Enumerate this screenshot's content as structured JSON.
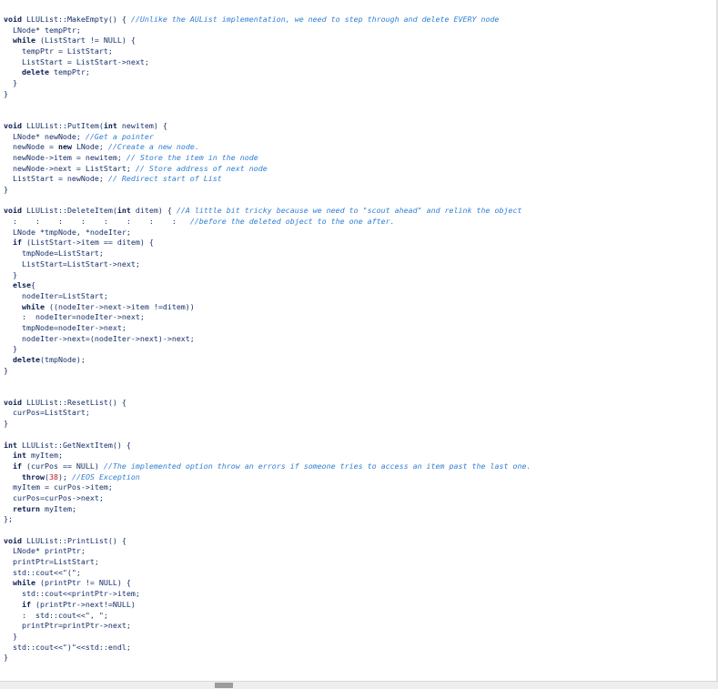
{
  "code": {
    "lines": [
      [
        {
          "k": "key",
          "t": "void "
        },
        {
          "k": "txt",
          "t": "LLUList::MakeEmpty() { "
        },
        {
          "k": "com",
          "t": "//Unlike the AUList implementation, we need to step through and delete EVERY node"
        }
      ],
      [
        {
          "k": "txt",
          "t": "  LNode* tempPtr;"
        }
      ],
      [
        {
          "k": "key",
          "t": "  while "
        },
        {
          "k": "txt",
          "t": "(ListStart != NULL) {"
        }
      ],
      [
        {
          "k": "txt",
          "t": "    tempPtr = ListStart;"
        }
      ],
      [
        {
          "k": "txt",
          "t": "    ListStart = ListStart->next;"
        }
      ],
      [
        {
          "k": "key",
          "t": "    delete "
        },
        {
          "k": "txt",
          "t": "tempPtr;"
        }
      ],
      [
        {
          "k": "txt",
          "t": "  }"
        }
      ],
      [
        {
          "k": "txt",
          "t": "}"
        }
      ],
      [],
      [],
      [
        {
          "k": "key",
          "t": "void "
        },
        {
          "k": "txt",
          "t": "LLUList::PutItem("
        },
        {
          "k": "key",
          "t": "int "
        },
        {
          "k": "txt",
          "t": "newitem) {"
        }
      ],
      [
        {
          "k": "txt",
          "t": "  LNode* newNode; "
        },
        {
          "k": "com",
          "t": "//Get a pointer"
        }
      ],
      [
        {
          "k": "txt",
          "t": "  newNode = "
        },
        {
          "k": "key",
          "t": "new "
        },
        {
          "k": "txt",
          "t": "LNode; "
        },
        {
          "k": "com",
          "t": "//Create a new node."
        }
      ],
      [
        {
          "k": "txt",
          "t": "  newNode->item = newitem; "
        },
        {
          "k": "com",
          "t": "// Store the item in the node"
        }
      ],
      [
        {
          "k": "txt",
          "t": "  newNode->next = ListStart; "
        },
        {
          "k": "com",
          "t": "// Store address of next node"
        }
      ],
      [
        {
          "k": "txt",
          "t": "  ListStart = newNode; "
        },
        {
          "k": "com",
          "t": "// Redirect start of List"
        }
      ],
      [
        {
          "k": "txt",
          "t": "}"
        }
      ],
      [],
      [
        {
          "k": "key",
          "t": "void "
        },
        {
          "k": "txt",
          "t": "LLUList::DeleteItem("
        },
        {
          "k": "key",
          "t": "int "
        },
        {
          "k": "txt",
          "t": "ditem) { "
        },
        {
          "k": "com",
          "t": "//A little bit tricky because we need to \"scout ahead\" and relink the object"
        }
      ],
      [
        {
          "k": "txt",
          "t": "  :    :    :    :    :    :    :    :   "
        },
        {
          "k": "com",
          "t": "//before the deleted object to the one after."
        }
      ],
      [
        {
          "k": "txt",
          "t": "  LNode *tmpNode, *nodeIter;"
        }
      ],
      [
        {
          "k": "key",
          "t": "  if "
        },
        {
          "k": "txt",
          "t": "(ListStart->item == ditem) {"
        }
      ],
      [
        {
          "k": "txt",
          "t": "    tmpNode=ListStart;"
        }
      ],
      [
        {
          "k": "txt",
          "t": "    ListStart=ListStart->next;"
        }
      ],
      [
        {
          "k": "txt",
          "t": "  }"
        }
      ],
      [
        {
          "k": "key",
          "t": "  else"
        },
        {
          "k": "txt",
          "t": "{"
        }
      ],
      [
        {
          "k": "txt",
          "t": "    nodeIter=ListStart;"
        }
      ],
      [
        {
          "k": "key",
          "t": "    while "
        },
        {
          "k": "txt",
          "t": "((nodeIter->next->item !=ditem))"
        }
      ],
      [
        {
          "k": "txt",
          "t": "    :  nodeIter=nodeIter->next;"
        }
      ],
      [
        {
          "k": "txt",
          "t": "    tmpNode=nodeIter->next;"
        }
      ],
      [
        {
          "k": "txt",
          "t": "    nodeIter->next=(nodeIter->next)->next;"
        }
      ],
      [
        {
          "k": "txt",
          "t": "  }"
        }
      ],
      [
        {
          "k": "key",
          "t": "  delete"
        },
        {
          "k": "txt",
          "t": "(tmpNode);"
        }
      ],
      [
        {
          "k": "txt",
          "t": "}"
        }
      ],
      [],
      [],
      [
        {
          "k": "key",
          "t": "void "
        },
        {
          "k": "txt",
          "t": "LLUList::ResetList() {"
        }
      ],
      [
        {
          "k": "txt",
          "t": "  curPos=ListStart;"
        }
      ],
      [
        {
          "k": "txt",
          "t": "}"
        }
      ],
      [],
      [
        {
          "k": "key",
          "t": "int "
        },
        {
          "k": "txt",
          "t": "LLUList::GetNextItem() {"
        }
      ],
      [
        {
          "k": "key",
          "t": "  int "
        },
        {
          "k": "txt",
          "t": "myItem;"
        }
      ],
      [
        {
          "k": "key",
          "t": "  if "
        },
        {
          "k": "txt",
          "t": "(curPos == NULL) "
        },
        {
          "k": "com",
          "t": "//The implemented option throw an errors if someone tries to access an item past the last one."
        }
      ],
      [
        {
          "k": "key",
          "t": "    throw"
        },
        {
          "k": "txt",
          "t": "("
        },
        {
          "k": "red",
          "t": "38"
        },
        {
          "k": "txt",
          "t": "); "
        },
        {
          "k": "com",
          "t": "//EOS Exception"
        }
      ],
      [
        {
          "k": "txt",
          "t": "  myItem = curPos->item;"
        }
      ],
      [
        {
          "k": "txt",
          "t": "  curPos=curPos->next;"
        }
      ],
      [
        {
          "k": "key",
          "t": "  return "
        },
        {
          "k": "txt",
          "t": "myItem;"
        }
      ],
      [
        {
          "k": "txt",
          "t": "};"
        }
      ],
      [],
      [
        {
          "k": "key",
          "t": "void "
        },
        {
          "k": "txt",
          "t": "LLUList::PrintList() {"
        }
      ],
      [
        {
          "k": "txt",
          "t": "  LNode* printPtr;"
        }
      ],
      [
        {
          "k": "txt",
          "t": "  printPtr=ListStart;"
        }
      ],
      [
        {
          "k": "txt",
          "t": "  std::cout<<\"(\";"
        }
      ],
      [
        {
          "k": "key",
          "t": "  while "
        },
        {
          "k": "txt",
          "t": "(printPtr != NULL) {"
        }
      ],
      [
        {
          "k": "txt",
          "t": "    std::cout<<printPtr->item;"
        }
      ],
      [
        {
          "k": "key",
          "t": "    if "
        },
        {
          "k": "txt",
          "t": "(printPtr->next!=NULL)"
        }
      ],
      [
        {
          "k": "txt",
          "t": "    :  std::cout<<\", \";"
        }
      ],
      [
        {
          "k": "txt",
          "t": "    printPtr=printPtr->next;"
        }
      ],
      [
        {
          "k": "txt",
          "t": "  }"
        }
      ],
      [
        {
          "k": "txt",
          "t": "  std::cout<<\")\"<<std::endl;"
        }
      ],
      [
        {
          "k": "txt",
          "t": "}"
        }
      ]
    ]
  }
}
